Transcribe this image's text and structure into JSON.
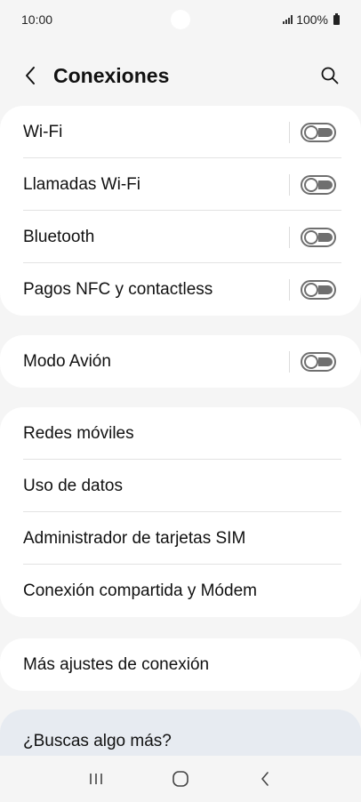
{
  "status": {
    "time": "10:00",
    "battery": "100%"
  },
  "header": {
    "title": "Conexiones"
  },
  "group1": [
    {
      "label": "Wi-Fi",
      "toggle": "off"
    },
    {
      "label": "Llamadas Wi-Fi",
      "toggle": "off"
    },
    {
      "label": "Bluetooth",
      "toggle": "off"
    },
    {
      "label": "Pagos NFC y contactless",
      "toggle": "off"
    }
  ],
  "group2": [
    {
      "label": "Modo Avión",
      "toggle": "off"
    }
  ],
  "group3": [
    {
      "label": "Redes móviles"
    },
    {
      "label": "Uso de datos"
    },
    {
      "label": "Administrador de tarjetas SIM"
    },
    {
      "label": "Conexión compartida y Módem"
    }
  ],
  "group4": [
    {
      "label": "Más ajustes de conexión"
    }
  ],
  "suggest": {
    "label": "¿Buscas algo más?"
  },
  "icons": {
    "back": "chevron-left-icon",
    "search": "search-icon",
    "recents": "recent-apps-icon",
    "home": "home-icon",
    "nav_back": "back-icon"
  },
  "colors": {
    "background": "#f5f5f5",
    "card": "#ffffff",
    "suggest": "#e7ebf1",
    "toggle": "#6f6f6f"
  }
}
